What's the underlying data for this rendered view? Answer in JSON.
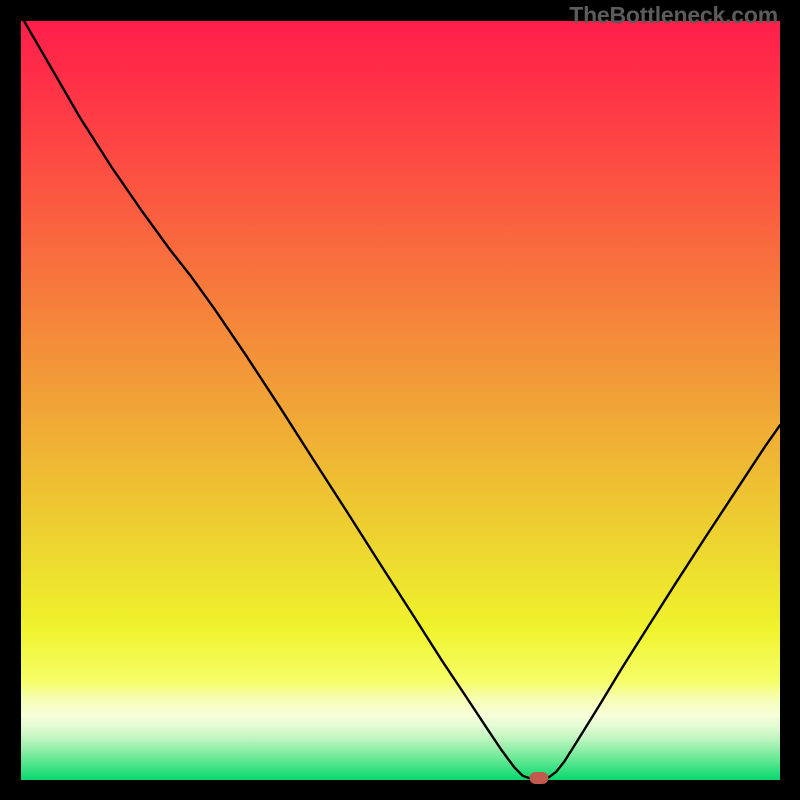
{
  "watermark": "TheBottleneck.com",
  "chart_data": {
    "type": "line",
    "title": "",
    "xlabel": "",
    "ylabel": "",
    "xlim": [
      0,
      100
    ],
    "ylim": [
      0,
      100
    ],
    "background_gradient_stops": [
      {
        "offset": 0.0,
        "color": "#ff1e4a"
      },
      {
        "offset": 0.067,
        "color": "#ff2d48"
      },
      {
        "offset": 0.133,
        "color": "#fe3e45"
      },
      {
        "offset": 0.2,
        "color": "#fc5042"
      },
      {
        "offset": 0.267,
        "color": "#fa623f"
      },
      {
        "offset": 0.333,
        "color": "#f7743d"
      },
      {
        "offset": 0.4,
        "color": "#f5873a"
      },
      {
        "offset": 0.467,
        "color": "#f29938"
      },
      {
        "offset": 0.533,
        "color": "#f0ab35"
      },
      {
        "offset": 0.6,
        "color": "#eebd33"
      },
      {
        "offset": 0.667,
        "color": "#edcf31"
      },
      {
        "offset": 0.733,
        "color": "#ede12e"
      },
      {
        "offset": 0.8,
        "color": "#eff32c"
      },
      {
        "offset": 0.87,
        "color": "#f6fe68"
      },
      {
        "offset": 0.892,
        "color": "#f6feb2"
      },
      {
        "offset": 0.915,
        "color": "#f7feda"
      },
      {
        "offset": 0.93,
        "color": "#e1fbd2"
      },
      {
        "offset": 0.945,
        "color": "#c0f6c0"
      },
      {
        "offset": 0.955,
        "color": "#a0f1af"
      },
      {
        "offset": 0.965,
        "color": "#7feca0"
      },
      {
        "offset": 0.975,
        "color": "#5ee791"
      },
      {
        "offset": 0.985,
        "color": "#3ce183"
      },
      {
        "offset": 0.99,
        "color": "#2bde7c"
      },
      {
        "offset": 1.0,
        "color": "#08d86f"
      }
    ],
    "series": [
      {
        "name": "bottleneck-curve",
        "xy": [
          [
            0.4,
            100.0
          ],
          [
            3.7,
            94.3
          ],
          [
            7.8,
            87.2
          ],
          [
            12.0,
            80.6
          ],
          [
            16.0,
            74.8
          ],
          [
            19.7,
            69.7
          ],
          [
            22.3,
            66.4
          ],
          [
            25.4,
            62.1
          ],
          [
            29.6,
            55.9
          ],
          [
            34.1,
            49.0
          ],
          [
            38.3,
            42.4
          ],
          [
            42.8,
            35.4
          ],
          [
            47.3,
            28.3
          ],
          [
            51.6,
            21.6
          ],
          [
            55.4,
            15.6
          ],
          [
            58.6,
            10.8
          ],
          [
            61.3,
            6.7
          ],
          [
            63.3,
            3.7
          ],
          [
            65.0,
            1.4
          ],
          [
            66.1,
            0.3
          ],
          [
            66.9,
            0.0
          ],
          [
            68.2,
            0.0
          ],
          [
            69.4,
            0.0
          ],
          [
            70.5,
            0.8
          ],
          [
            71.6,
            2.2
          ],
          [
            73.3,
            4.9
          ],
          [
            76.2,
            9.6
          ],
          [
            79.1,
            14.4
          ],
          [
            82.5,
            19.8
          ],
          [
            86.3,
            25.8
          ],
          [
            90.3,
            32.0
          ],
          [
            94.3,
            38.1
          ],
          [
            98.1,
            43.9
          ],
          [
            100.0,
            46.6
          ]
        ]
      }
    ],
    "marker": {
      "x": 68.3,
      "y": 0.0,
      "color": "#c1594d"
    }
  }
}
